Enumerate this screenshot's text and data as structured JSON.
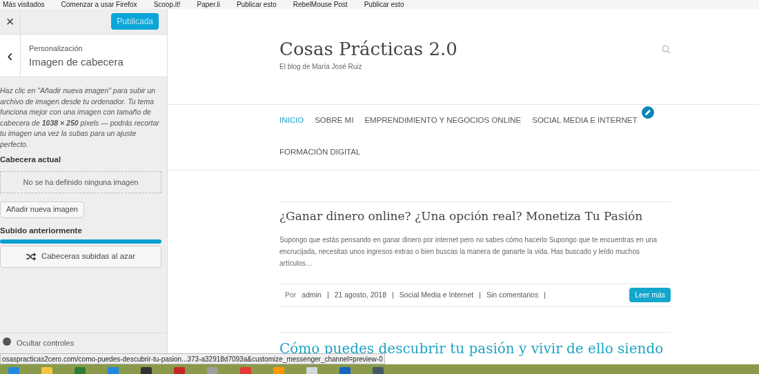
{
  "bookmarks": [
    {
      "label": "Más visitados"
    },
    {
      "label": "Comenzar a usar Firefox"
    },
    {
      "label": "Scoop.it!"
    },
    {
      "label": "Paper.li"
    },
    {
      "label": "Publicar esto"
    },
    {
      "label": "RebelMouse Post"
    },
    {
      "label": "Publicar esto"
    }
  ],
  "sidebar": {
    "close": "×",
    "publish_button": "Publicada",
    "back": "‹",
    "breadcrumb": "Personalización",
    "title": "Imagen de cabecera",
    "description": "Haz clic en \"Añadir nueva imagen\" para subir un archivo de imagen desde tu ordenador. Tu tema funciona mejor con una imagen con tamaño de cabecera de **1038 × 250** pixels — podrás recortar tu imagen una vez la subas para un ajuste perfecto.",
    "current_header_label": "Cabecera actual",
    "current_header_empty": "No se ha definido ninguna imagen",
    "add_button": "Añadir nueva imagen",
    "uploaded_label": "Subido anteriormente",
    "randomize_button": "Cabeceras subidas al azar",
    "hide_controls": "Ocultar controles"
  },
  "preview": {
    "site_title": "Cosas Prácticas 2.0",
    "tagline": "El blog de María José Ruiz",
    "nav": [
      {
        "label": "INICIO",
        "selected": true,
        "edit_shortcut": false
      },
      {
        "label": "SOBRE MI",
        "selected": false,
        "edit_shortcut": false
      },
      {
        "label": "EMPRENDIMIENTO Y NEGOCIOS ONLINE",
        "selected": false,
        "edit_shortcut": false
      },
      {
        "label": "SOCIAL MEDIA E INTERNET",
        "selected": false,
        "edit_shortcut": true
      },
      {
        "label": "FORMACIÓN DIGITAL",
        "selected": false,
        "edit_shortcut": false
      }
    ],
    "posts": [
      {
        "title": "¿Ganar dinero online? ¿Una opción real? Monetiza Tu Pasión",
        "highlighted": false,
        "excerpt": "Supongo que estás pensando en ganar dinero por internet pero no sabes cómo hacerlo Supongo que te encuentras  en una encrucijada, necesitas unos ingresos extras o bien buscas la manera de ganarte la vida.  Has buscado y  leído muchos artículos…",
        "meta": {
          "by": "Por",
          "author": "admin",
          "date": "21 agosto, 2018",
          "category": "Social Media e Internet",
          "comments": "Sin comentarios",
          "separator": "|"
        },
        "read_more": "Leer más"
      },
      {
        "title": "Cómo puedes descubrir tu pasión y vivir de ello siendo",
        "highlighted": true
      }
    ]
  },
  "status_url": "osaspracticas2cero.com/como-puedes-descubrir-tu-pasion...373-a32918d7093a&customize_messenger_channel=preview-0"
}
